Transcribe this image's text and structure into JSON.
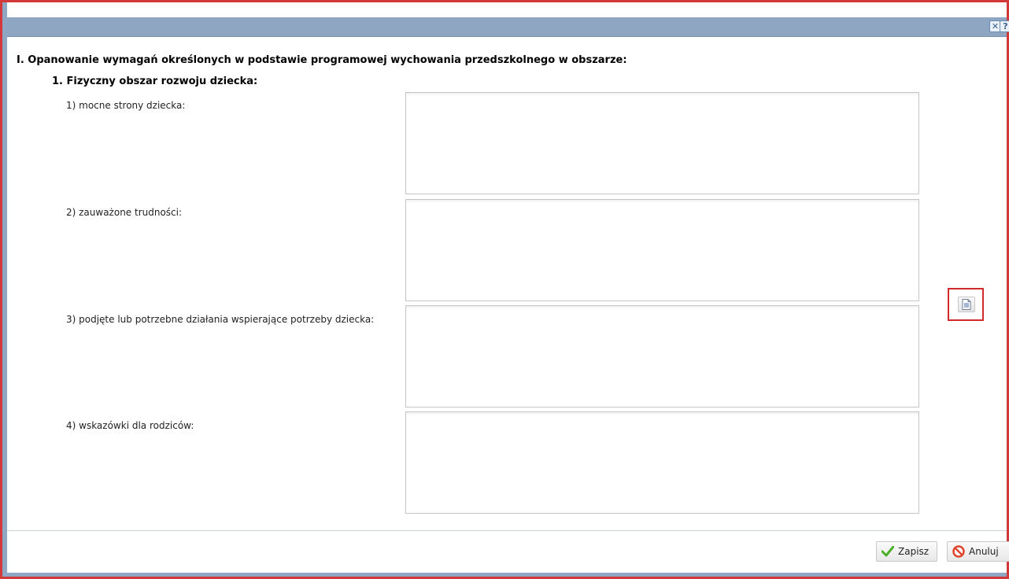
{
  "titlebar": {
    "close_symbol": "✕",
    "help_symbol": "?"
  },
  "form": {
    "section_title": "I. Opanowanie wymagań określonych w podstawie programowej wychowania przedszkolnego w obszarze:",
    "subsection_title": "1. Fizyczny obszar rozwoju dziecka:",
    "fields": [
      {
        "label": "1) mocne strony dziecka:",
        "value": ""
      },
      {
        "label": "2) zauważone trudności:",
        "value": ""
      },
      {
        "label": "3) podjęte lub potrzebne działania wspierające potrzeby dziecka:",
        "value": ""
      },
      {
        "label": "4) wskazówki dla rodziców:",
        "value": ""
      }
    ]
  },
  "footer": {
    "save_label": "Zapisz",
    "cancel_label": "Anuluj"
  },
  "icons": {
    "close": "close-icon",
    "help": "help-icon",
    "document": "document-icon",
    "checkmark": "checkmark-icon",
    "cancel": "no-entry-icon"
  },
  "colors": {
    "titlebar": "#8fa6c3",
    "highlight_border": "#d22a2a",
    "save_icon": "#4caf2a",
    "cancel_icon": "#e0452d"
  }
}
